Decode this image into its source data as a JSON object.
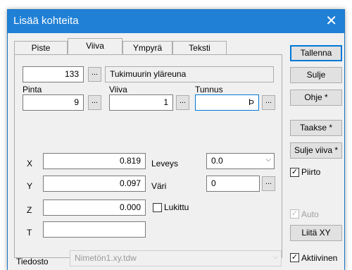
{
  "window": {
    "title": "Lisää kohteita",
    "close_glyph": "✕"
  },
  "tabs": [
    "Piste",
    "Viiva",
    "Ympyrä",
    "Teksti"
  ],
  "active_tab": "Viiva",
  "row1": {
    "number": "133",
    "name": "Tukimuurin yläreuna"
  },
  "row2": {
    "pinta_label": "Pinta",
    "pinta_value": "9",
    "viiva_label": "Viiva",
    "viiva_value": "1",
    "tunnus_label": "Tunnus",
    "tunnus_value": "Þ"
  },
  "coords": {
    "x_label": "X",
    "x_value": "0.819",
    "y_label": "Y",
    "y_value": "0.097",
    "z_label": "Z",
    "z_value": "0.000",
    "t_label": "T",
    "t_value": ""
  },
  "leveys": {
    "label": "Leveys",
    "value": "0.0"
  },
  "vari": {
    "label": "Väri",
    "value": "0"
  },
  "lukittu": {
    "label": "Lukittu",
    "checked": false
  },
  "ellipsis": "...",
  "buttons": {
    "tallenna": "Tallenna",
    "sulje": "Sulje",
    "ohje": "Ohje *",
    "taakse": "Taakse *",
    "sulje_viiva": "Sulje viiva *",
    "liita_xy": "Liitä XY"
  },
  "piirto": {
    "label": "Piirto",
    "checked": true
  },
  "auto": {
    "label": "Auto",
    "checked": true,
    "disabled": true
  },
  "aktiivinen": {
    "label": "Aktiivinen",
    "checked": true
  },
  "tiedosto": {
    "label": "Tiedosto",
    "value": "Nimetön1.xy.tdw"
  },
  "check_glyph": "✓",
  "arrow_glyph": "⌵",
  "colors": {
    "titlebar": "#1f80d6",
    "window_bg": "#f0f0f0",
    "focus": "#0078d7"
  }
}
